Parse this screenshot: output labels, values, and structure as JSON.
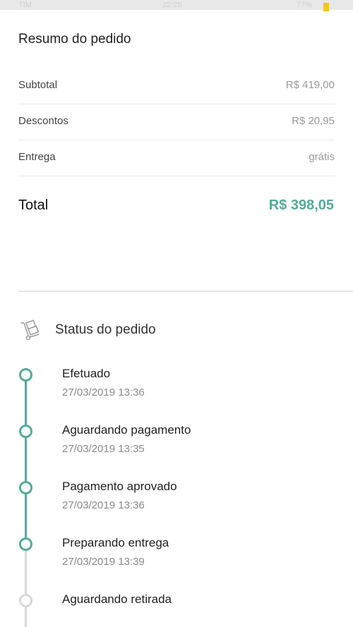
{
  "statusbar": {
    "carrier": "TIM",
    "time": "22:26",
    "battery": "77%"
  },
  "summary": {
    "title": "Resumo do pedido",
    "rows": [
      {
        "label": "Subtotal",
        "value": "R$ 419,00"
      },
      {
        "label": "Descontos",
        "value": "R$ 20,95"
      },
      {
        "label": "Entrega",
        "value": "grátis"
      }
    ],
    "total_label": "Total",
    "total_value": "R$ 398,05",
    "accent_color": "#56ab99"
  },
  "status": {
    "title": "Status do pedido",
    "icon": "hand-truck-icon",
    "steps": [
      {
        "name": "Efetuado",
        "date": "27/03/2019 13:36",
        "done": true
      },
      {
        "name": "Aguardando pagamento",
        "date": "27/03/2019 13:35",
        "done": true
      },
      {
        "name": "Pagamento aprovado",
        "date": "27/03/2019 13:36",
        "done": true
      },
      {
        "name": "Preparando entrega",
        "date": "27/03/2019 13:39",
        "done": true
      },
      {
        "name": "Aguardando retirada",
        "date": "",
        "done": false
      }
    ]
  }
}
